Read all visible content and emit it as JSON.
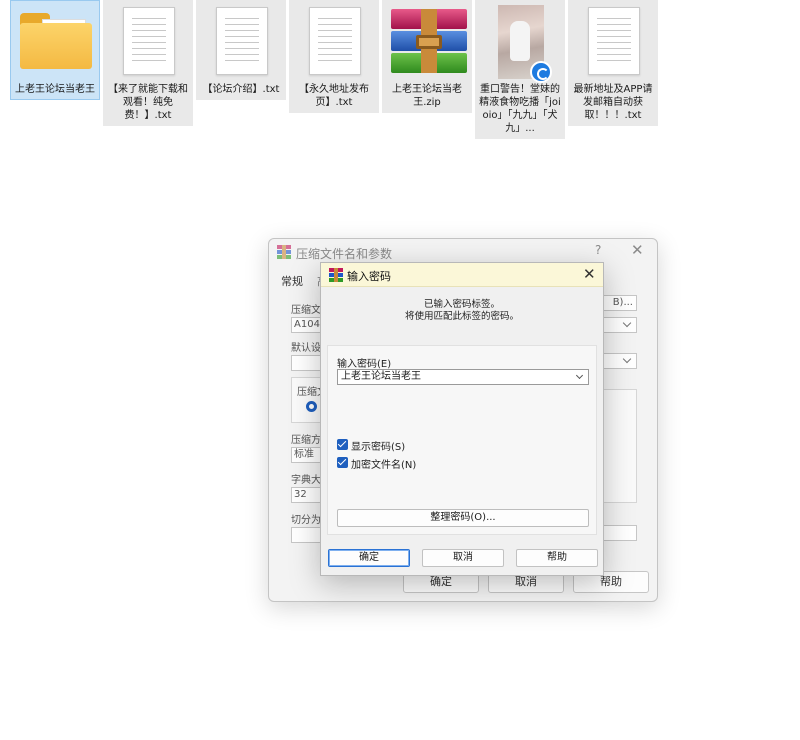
{
  "files": [
    {
      "name": "上老王论坛当老王",
      "kind": "folder"
    },
    {
      "name": "【来了就能下载和观看！纯免费！】.txt",
      "kind": "text"
    },
    {
      "name": "【论坛介绍】.txt",
      "kind": "text"
    },
    {
      "name": "【永久地址发布页】.txt",
      "kind": "text"
    },
    {
      "name": "上老王论坛当老王.zip",
      "kind": "archive"
    },
    {
      "name": "重口警告！堂妹的精液食物吃播「joioio」「九九」「犬九」...",
      "kind": "video"
    },
    {
      "name": "最新地址及APP请发邮箱自动获取！！！.txt",
      "kind": "text"
    }
  ],
  "bg_dialog": {
    "title": "压缩文件名和参数",
    "help_glyph": "?",
    "close_glyph": "✕",
    "tab_general": "常规",
    "tab_partial": "高",
    "archive_label": "压缩文",
    "archive_value": "A104",
    "browse_partial": "B)...",
    "profile_label": "默认设",
    "format_label": "压缩文",
    "method_label": "压缩方",
    "method_value": "标准",
    "dict_label": "字典大",
    "dict_value": "32",
    "split_label": "切分为",
    "ok": "确定",
    "cancel": "取消",
    "help": "帮助"
  },
  "pw_dialog": {
    "title": "输入密码",
    "close_glyph": "✕",
    "info_line1": "已输入密码标签。",
    "info_line2": "将使用匹配此标签的密码。",
    "password_label": "输入密码(E)",
    "password_value": "上老王论坛当老王",
    "show_password_label": "显示密码(S)",
    "encrypt_names_label": "加密文件名(N)",
    "show_password_checked": true,
    "encrypt_names_checked": true,
    "organize_button": "整理密码(O)...",
    "ok": "确定",
    "cancel": "取消",
    "help": "帮助"
  }
}
